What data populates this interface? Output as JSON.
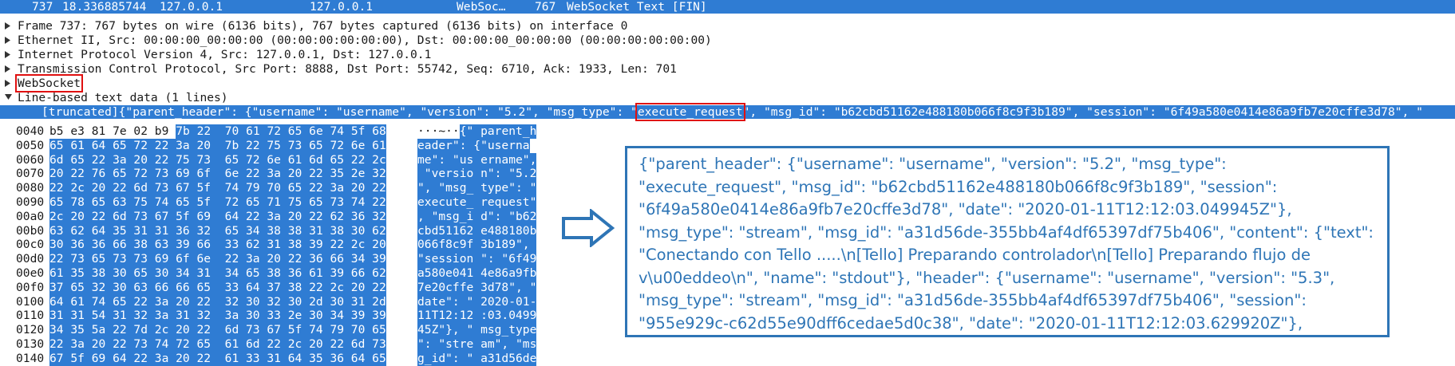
{
  "packet_row": {
    "number": "737",
    "time": "18.336885744",
    "source": "127.0.0.1",
    "destination": "127.0.0.1",
    "protocol": "WebSoc…",
    "length": "767",
    "info": "WebSocket Text [FIN]"
  },
  "tree": {
    "frame": "Frame 737: 767 bytes on wire (6136 bits), 767 bytes captured (6136 bits) on interface 0",
    "ethernet": "Ethernet II, Src: 00:00:00_00:00:00 (00:00:00:00:00:00), Dst: 00:00:00_00:00:00 (00:00:00:00:00:00)",
    "ip": "Internet Protocol Version 4, Src: 127.0.0.1, Dst: 127.0.0.1",
    "tcp": "Transmission Control Protocol, Src Port: 8888, Dst Port: 55742, Seq: 6710, Ack: 1933, Len: 701",
    "websocket": "WebSocket",
    "line_based": "Line-based text data (1 lines)",
    "selected_prefix": "[truncated]{\"parent_header\": {\"username\": \"username\", \"version\": \"5.2\", \"msg_type\": \"",
    "selected_highlight": "execute_request",
    "selected_suffix": "\", \"msg_id\": \"b62cbd51162e488180b066f8c9f3b189\", \"session\": \"6f49a580e0414e86a9fb7e20cffe3d78\", \""
  },
  "hex_rows": [
    {
      "offset": "0040",
      "plain": "b5 e3 81 7e 02 b9 ",
      "sel": "7b 22  70 61 72 65 6e 74 5f 68",
      "ascii_plain": "···~··",
      "ascii_sel": "{\" parent_h"
    },
    {
      "offset": "0050",
      "plain": "",
      "sel": "65 61 64 65 72 22 3a 20  7b 22 75 73 65 72 6e 61",
      "ascii_plain": "",
      "ascii_sel": "eader\": {\"userna"
    },
    {
      "offset": "0060",
      "plain": "",
      "sel": "6d 65 22 3a 20 22 75 73  65 72 6e 61 6d 65 22 2c",
      "ascii_plain": "",
      "ascii_sel": "me\": \"us ername\","
    },
    {
      "offset": "0070",
      "plain": "",
      "sel": "20 22 76 65 72 73 69 6f  6e 22 3a 20 22 35 2e 32",
      "ascii_plain": "",
      "ascii_sel": " \"versio n\": \"5.2"
    },
    {
      "offset": "0080",
      "plain": "",
      "sel": "22 2c 20 22 6d 73 67 5f  74 79 70 65 22 3a 20 22",
      "ascii_plain": "",
      "ascii_sel": "\", \"msg_ type\": \""
    },
    {
      "offset": "0090",
      "plain": "",
      "sel": "65 78 65 63 75 74 65 5f  72 65 71 75 65 73 74 22",
      "ascii_plain": "",
      "ascii_sel": "execute_ request\""
    },
    {
      "offset": "00a0",
      "plain": "",
      "sel": "2c 20 22 6d 73 67 5f 69  64 22 3a 20 22 62 36 32",
      "ascii_plain": "",
      "ascii_sel": ", \"msg_i d\": \"b62"
    },
    {
      "offset": "00b0",
      "plain": "",
      "sel": "63 62 64 35 31 31 36 32  65 34 38 38 31 38 30 62",
      "ascii_plain": "",
      "ascii_sel": "cbd51162 e488180b"
    },
    {
      "offset": "00c0",
      "plain": "",
      "sel": "30 36 36 66 38 63 39 66  33 62 31 38 39 22 2c 20",
      "ascii_plain": "",
      "ascii_sel": "066f8c9f 3b189\", "
    },
    {
      "offset": "00d0",
      "plain": "",
      "sel": "22 73 65 73 73 69 6f 6e  22 3a 20 22 36 66 34 39",
      "ascii_plain": "",
      "ascii_sel": "\"session \": \"6f49"
    },
    {
      "offset": "00e0",
      "plain": "",
      "sel": "61 35 38 30 65 30 34 31  34 65 38 36 61 39 66 62",
      "ascii_plain": "",
      "ascii_sel": "a580e041 4e86a9fb"
    },
    {
      "offset": "00f0",
      "plain": "",
      "sel": "37 65 32 30 63 66 66 65  33 64 37 38 22 2c 20 22",
      "ascii_plain": "",
      "ascii_sel": "7e20cffe 3d78\", \""
    },
    {
      "offset": "0100",
      "plain": "",
      "sel": "64 61 74 65 22 3a 20 22  32 30 32 30 2d 30 31 2d",
      "ascii_plain": "",
      "ascii_sel": "date\": \" 2020-01-"
    },
    {
      "offset": "0110",
      "plain": "",
      "sel": "31 31 54 31 32 3a 31 32  3a 30 33 2e 30 34 39 39",
      "ascii_plain": "",
      "ascii_sel": "11T12:12 :03.0499"
    },
    {
      "offset": "0120",
      "plain": "",
      "sel": "34 35 5a 22 7d 2c 20 22  6d 73 67 5f 74 79 70 65",
      "ascii_plain": "",
      "ascii_sel": "45Z\"}, \" msg_type"
    },
    {
      "offset": "0130",
      "plain": "",
      "sel": "22 3a 20 22 73 74 72 65  61 6d 22 2c 20 22 6d 73",
      "ascii_plain": "",
      "ascii_sel": "\": \"stre am\", \"ms"
    },
    {
      "offset": "0140",
      "plain": "",
      "sel": "67 5f 69 64 22 3a 20 22  61 33 31 64 35 36 64 65",
      "ascii_plain": "",
      "ascii_sel": "g_id\": \" a31d56de"
    }
  ],
  "decoded_text": "{\"parent_header\": {\"username\": \"username\", \"version\": \"5.2\", \"msg_type\": \"execute_request\", \"msg_id\": \"b62cbd51162e488180b066f8c9f3b189\", \"session\": \"6f49a580e0414e86a9fb7e20cffe3d78\", \"date\": \"2020-01-11T12:12:03.049945Z\"}, \"msg_type\": \"stream\", \"msg_id\": \"a31d56de-355bb4af4df65397df75b406\", \"content\": {\"text\": \"Conectando con Tello .....\\n[Tello] Preparando controlador\\n[Tello] Preparando flujo de v\\u00eddeo\\n\", \"name\": \"stdout\"}, \"header\": {\"username\": \"username\", \"version\": \"5.3\", \"msg_type\": \"stream\", \"msg_id\": \"a31d56de-355bb4af4df65397df75b406\", \"session\": \"955e929c-c62d55e90dff6cedae5d0c38\", \"date\": \"2020-01-11T12:12:03.629920Z\"}, \"channel\": \"iopub\", \"buffers\": [], \"metadata\": {}}",
  "icons": {
    "tree_expander": "triangle-icon",
    "arrow": "right-arrow-icon"
  },
  "colors": {
    "selection": "#2f7cd3",
    "annotation_box": "#2e75b6",
    "highlight_box": "#e01010"
  }
}
